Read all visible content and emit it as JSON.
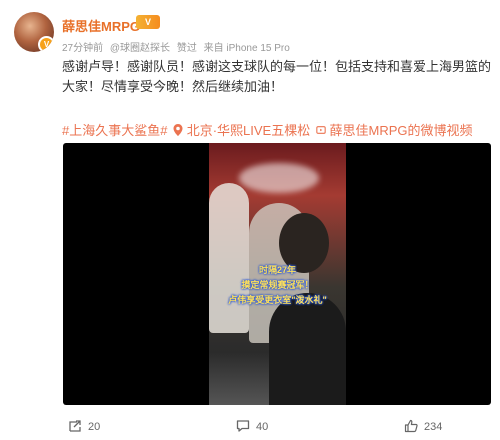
{
  "post": {
    "author": "薛思佳MRPG",
    "vip_badge": "V",
    "time": "27分钟前",
    "via_prefix": "@球圈赵探长",
    "liked": "赞过",
    "source": "来自 iPhone 15 Pro",
    "text": "感谢卢导！感谢队员！感谢这支球队的每一位！包括支持和喜爱上海男篮的大家！尽情享受今晚！然后继续加油！",
    "tags": {
      "topic": "#上海久事大鲨鱼#",
      "location": "北京·华熙LIVE五棵松",
      "video_link": "薛思佳MRPG的微博视频"
    },
    "video_captions": {
      "line1": "时隔27年",
      "line2": "摸定常规赛冠军！",
      "line3": "卢伟享受更衣室\"泼水礼\""
    }
  },
  "actions": {
    "reposts": "20",
    "comments": "40",
    "likes": "234"
  },
  "colors": {
    "accent": "#eb7350",
    "author": "#e8712a"
  }
}
